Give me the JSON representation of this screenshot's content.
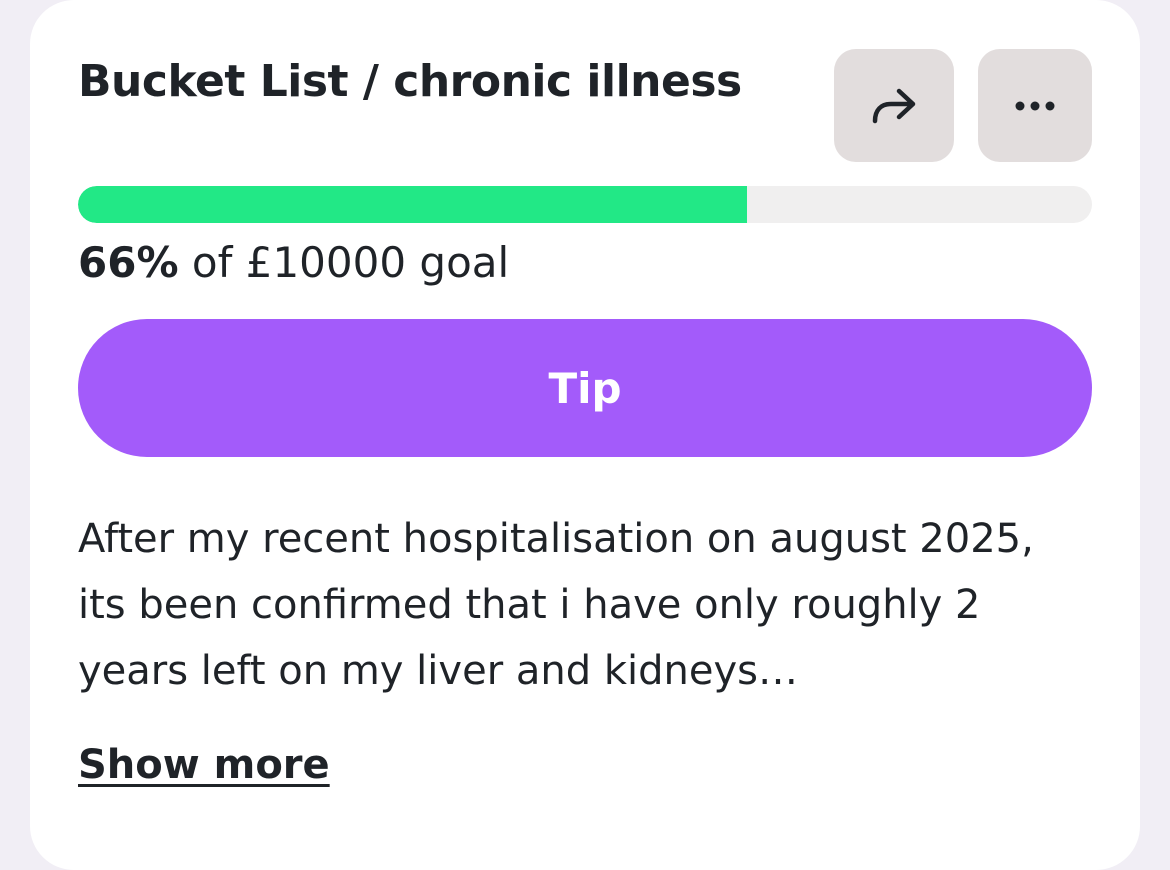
{
  "campaign": {
    "title": "Bucket List / chronic illness",
    "progress_percent": 66,
    "progress_label": "66%",
    "goal_text": "of £10000 goal",
    "description": "After my recent hospitalisation on august 2025, its been confirmed that i have only roughly 2 years left on my liver and kidneys…"
  },
  "actions": {
    "share_icon": "share-arrow-icon",
    "more_icon": "more-dots-icon",
    "tip_label": "Tip",
    "show_more_label": "Show more"
  },
  "colors": {
    "progress_fill": "#22e886",
    "progress_track": "#f0efef",
    "tip_button": "#a35bfa",
    "icon_button_bg": "#e2dddd",
    "text": "#1f2328"
  }
}
